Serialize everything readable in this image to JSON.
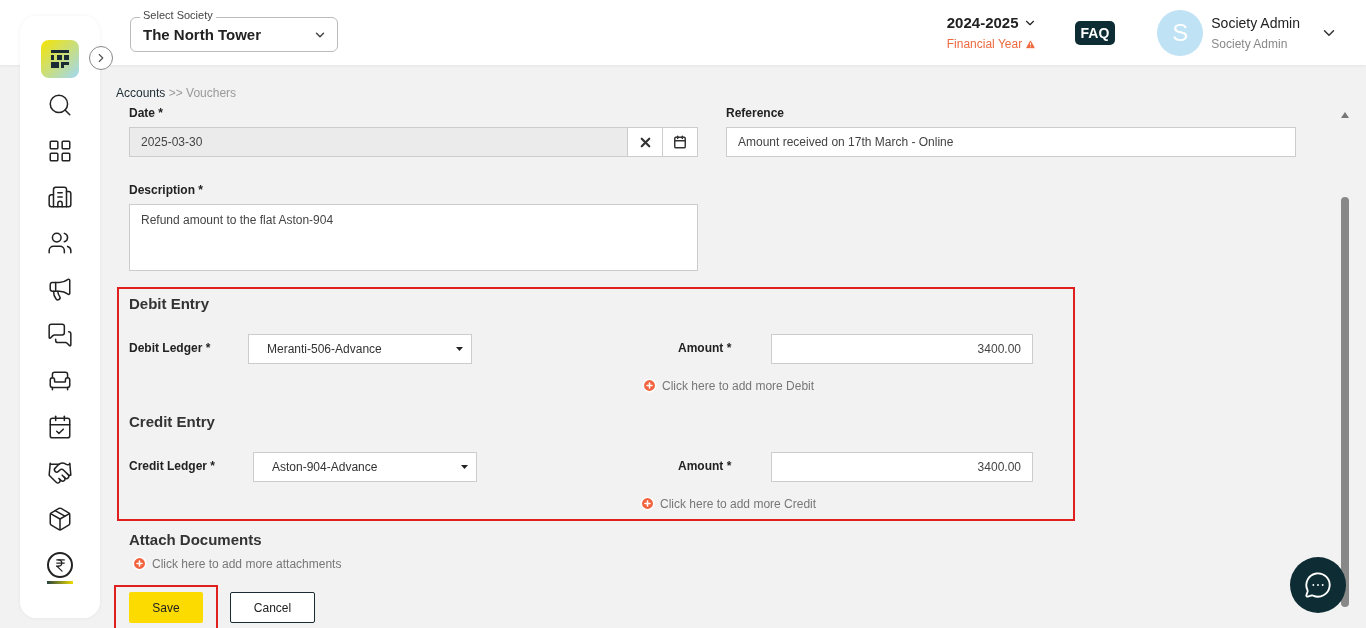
{
  "header": {
    "society_select": {
      "label": "Select Society",
      "value": "The North Tower"
    },
    "financial_year": {
      "value": "2024-2025",
      "label": "Financial Year"
    },
    "faq": "FAQ",
    "user": {
      "initial": "S",
      "name": "Society Admin",
      "role": "Society Admin"
    }
  },
  "sidebar": {
    "items": [
      {
        "selected": false
      },
      {
        "selected": false
      },
      {
        "selected": false
      },
      {
        "selected": false
      },
      {
        "selected": false
      },
      {
        "selected": false
      },
      {
        "selected": false
      },
      {
        "selected": false
      },
      {
        "selected": false
      },
      {
        "selected": false
      },
      {
        "selected": true
      }
    ]
  },
  "breadcrumb": {
    "parent": "Accounts",
    "separator": ">>",
    "current": "Vouchers"
  },
  "form": {
    "date": {
      "label": "Date *",
      "value": "2025-03-30"
    },
    "reference": {
      "label": "Reference",
      "value": "Amount received on 17th March - Online"
    },
    "description": {
      "label": "Description *",
      "value": "Refund amount to the flat Aston-904"
    },
    "entries": [
      {
        "title": "Debit Entry",
        "ledger_label": "Debit Ledger *",
        "ledger_value": "Meranti-506-Advance",
        "amount_label": "Amount *",
        "amount_value": "3400.00",
        "add_link": "Click here to add more Debit"
      },
      {
        "title": "Credit Entry",
        "ledger_label": "Credit Ledger *",
        "ledger_value": "Aston-904-Advance",
        "amount_label": "Amount *",
        "amount_value": "3400.00",
        "add_link": "Click here to add more Credit"
      }
    ],
    "attach": {
      "title": "Attach Documents",
      "link": "Click here to add more attachments"
    },
    "buttons": {
      "save": "Save",
      "cancel": "Cancel"
    }
  }
}
